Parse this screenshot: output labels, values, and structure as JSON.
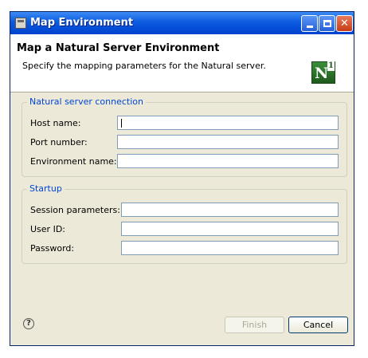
{
  "window": {
    "title": "Map Environment"
  },
  "header": {
    "title": "Map a Natural Server Environment",
    "description": "Specify the mapping parameters for the Natural server.",
    "logo_letter": "N",
    "logo_superscript": "1"
  },
  "connection": {
    "legend": "Natural server connection",
    "host_label": "Host name:",
    "host_value": "",
    "port_label": "Port number:",
    "port_value": "",
    "env_label": "Environment name:",
    "env_value": ""
  },
  "startup": {
    "legend": "Startup",
    "session_label": "Session parameters:",
    "session_value": "",
    "userid_label": "User ID:",
    "userid_value": "",
    "password_label": "Password:",
    "password_value": ""
  },
  "buttons": {
    "help_glyph": "?",
    "finish": "Finish",
    "cancel": "Cancel"
  },
  "colors": {
    "titlebar": "#0b5be0",
    "legend_text": "#0046d5",
    "dialog_bg": "#ece9d8"
  }
}
